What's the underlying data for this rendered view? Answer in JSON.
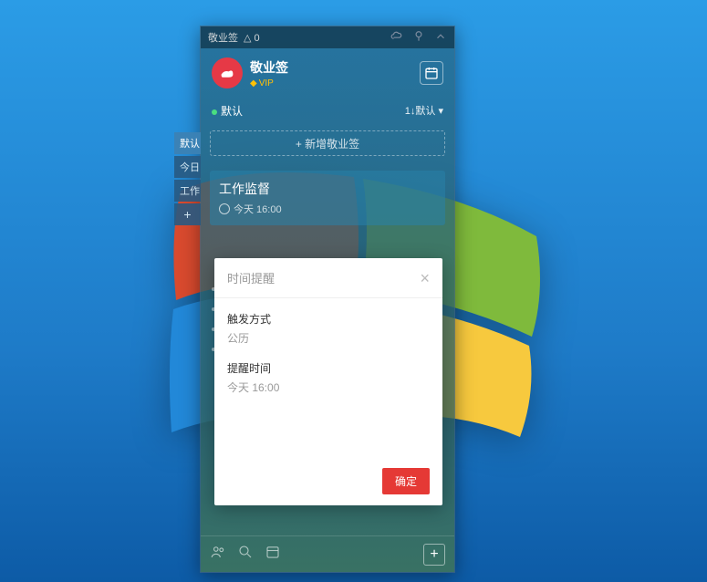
{
  "titlebar": {
    "name": "敬业签",
    "notif_count": "0"
  },
  "header": {
    "title": "敬业签",
    "vip": "VIP"
  },
  "tabs": {
    "active": "默认",
    "sort": "1↓默认"
  },
  "add_button": "+ 新增敬业签",
  "card": {
    "title": "工作监督",
    "time": "今天 16:00"
  },
  "side_tabs": [
    "默认",
    "今日",
    "工作"
  ],
  "dialog": {
    "title": "时间提醒",
    "trigger_label": "触发方式",
    "trigger_value": "公历",
    "time_label": "提醒时间",
    "time_value": "今天 16:00",
    "ok": "确定"
  }
}
